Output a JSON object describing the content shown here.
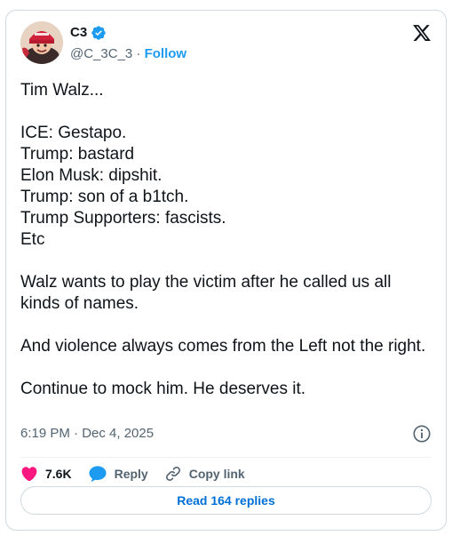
{
  "author": {
    "name": "C3",
    "handle": "@C_3C_3",
    "separator": "·",
    "follow_label": "Follow",
    "verified_icon": "verified-badge-icon",
    "avatar_icon": "avatar-image"
  },
  "platform_icon": "x-logo-icon",
  "tweet": {
    "lines": [
      "Tim Walz...",
      "",
      "ICE: Gestapo.",
      "Trump: bastard",
      "Elon Musk: dipshit.",
      "Trump: son of a b1tch.",
      "Trump Supporters: fascists.",
      "Etc",
      "",
      "Walz wants to play the victim after he called us all kinds of names.",
      "",
      "And violence always comes from the Left not the right.",
      "",
      "Continue to mock him. He deserves it."
    ]
  },
  "meta": {
    "timestamp": "6:19 PM · Dec 4, 2025",
    "info_icon": "info-icon"
  },
  "actions": {
    "like_count": "7.6K",
    "like_icon": "heart-icon",
    "reply_label": "Reply",
    "reply_icon": "reply-bubble-icon",
    "copy_label": "Copy link",
    "copy_icon": "link-icon"
  },
  "replies_button": {
    "label": "Read 164 replies"
  },
  "colors": {
    "accent": "#1d9bf0",
    "like": "#f91880",
    "muted": "#536471",
    "text": "#0f1419",
    "border": "#cfd9de"
  }
}
